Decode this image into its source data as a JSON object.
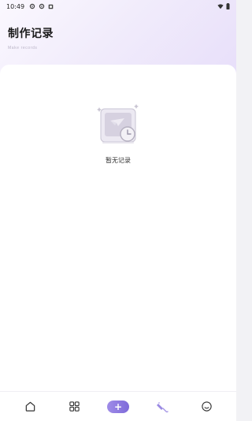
{
  "status_bar": {
    "time": "10:49"
  },
  "header": {
    "title": "制作记录",
    "subtitle": "Make records"
  },
  "empty_state": {
    "message": "暂无记录",
    "icon": "empty-records-icon"
  },
  "bottom_nav": {
    "items": [
      {
        "icon": "home-icon"
      },
      {
        "icon": "grid-icon"
      },
      {
        "icon": "add-icon",
        "label": "+"
      },
      {
        "icon": "brush-icon"
      },
      {
        "icon": "profile-icon"
      }
    ]
  },
  "colors": {
    "accent": "#8a76de",
    "header_gradient_start": "#fbf8ff",
    "header_gradient_end": "#e7defa",
    "icon_gray": "#b8b8c4"
  }
}
